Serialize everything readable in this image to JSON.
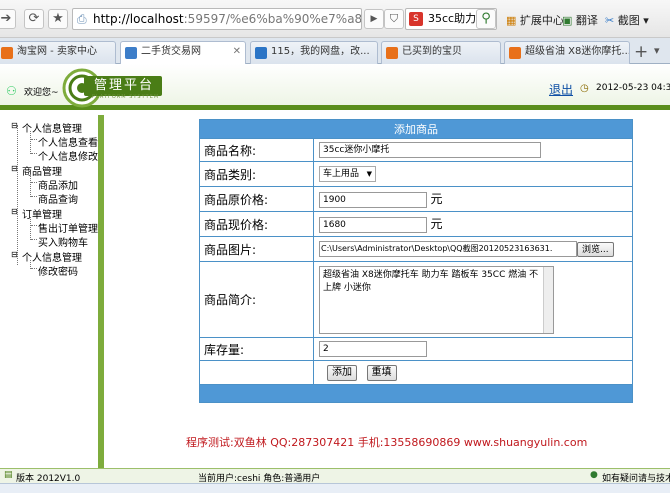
{
  "browser": {
    "url_host": "http://localhost",
    "url_rest": ":59597/%e6%ba%90%e7%a8%8b%e5%b",
    "search_text": "35cc助力",
    "ext_label": "扩展中心",
    "translate_label": "翻译",
    "screenshot_label": "截图"
  },
  "tabs": [
    {
      "label": "淘宝网 - 卖家中心",
      "fav_color": "#e8701a"
    },
    {
      "label": "二手货交易网",
      "fav_color": "#3d7ec9"
    },
    {
      "label": "115，我的网盘，改...",
      "fav_color": "#2c75c6"
    },
    {
      "label": "已买到的宝贝",
      "fav_color": "#e8701a"
    },
    {
      "label": "超级省油 X8迷你摩托...",
      "fav_color": "#e8701a"
    }
  ],
  "header": {
    "welcome": "欢迎您~",
    "brand": "管理平台",
    "brand_sub": "PLATFORM SYSYTEM",
    "logout": "退出",
    "datetime": "2012-05-23 04:3"
  },
  "sidebar": {
    "groups": [
      {
        "label": "个人信息管理",
        "items": [
          "个人信息查看",
          "个人信息修改"
        ]
      },
      {
        "label": "商品管理",
        "items": [
          "商品添加",
          "商品查询"
        ]
      },
      {
        "label": "订单管理",
        "items": [
          "售出订单管理",
          "买入购物车"
        ]
      },
      {
        "label": "个人信息管理",
        "items": [
          "修改密码"
        ]
      }
    ]
  },
  "form": {
    "title": "添加商品",
    "name_label": "商品名称:",
    "name_value": "35cc迷你小摩托",
    "category_label": "商品类别:",
    "category_value": "车上用品",
    "orig_price_label": "商品原价格:",
    "orig_price_value": "1900",
    "cur_price_label": "商品现价格:",
    "cur_price_value": "1680",
    "unit": "元",
    "image_label": "商品图片:",
    "image_value": "C:\\Users\\Administrator\\Desktop\\QQ截图20120523163631.",
    "browse_label": "浏览...",
    "intro_label": "商品简介:",
    "intro_value": "超级省油 X8迷你摩托车 助力车 踏板车 35CC 燃油 不上牌 小迷你",
    "stock_label": "库存量:",
    "stock_value": "2",
    "add_button": "添加",
    "reset_button": "重填"
  },
  "credit": "程序测试:双鱼林 QQ:287307421 手机:13558690869 www.shuangyulin.com",
  "status": {
    "version": "版本 2012V1.0",
    "current_user": "当前用户:ceshi 角色:普通用户",
    "contact": "如有疑问请与技术"
  },
  "colors": {
    "brand_green": "#4a7d16",
    "form_blue": "#4f98d6",
    "credit_red": "#c0181d"
  }
}
